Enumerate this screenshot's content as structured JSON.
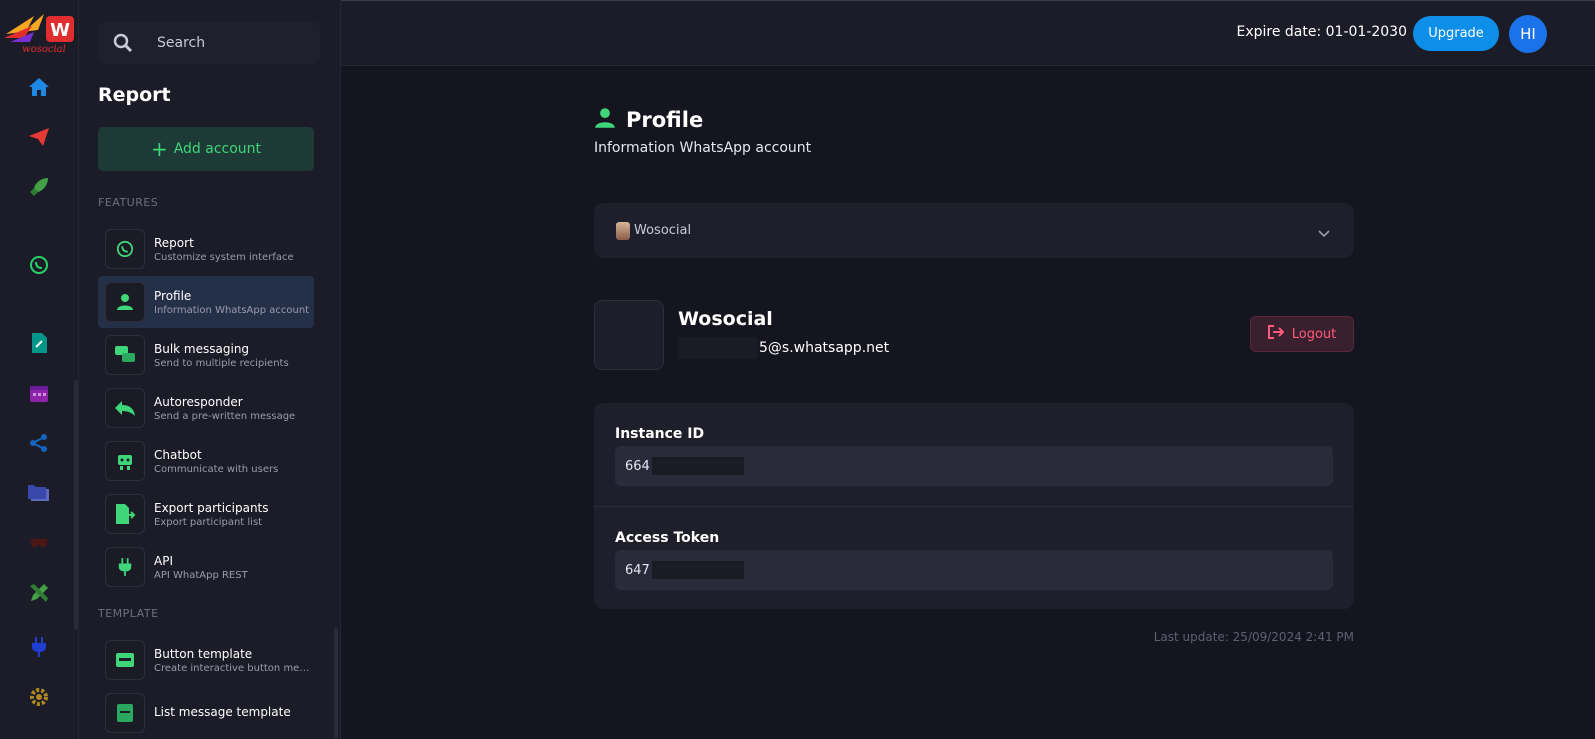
{
  "brand": {
    "logo_text": "wosocial"
  },
  "search": {
    "placeholder": "Search"
  },
  "panel": {
    "title": "Report",
    "add_account_label": "Add account",
    "sections": {
      "features": "FEATURES",
      "template": "TEMPLATE"
    },
    "features": [
      {
        "label": "Report",
        "desc": "Customize system interface"
      },
      {
        "label": "Profile",
        "desc": "Information WhatsApp account"
      },
      {
        "label": "Bulk messaging",
        "desc": "Send to multiple recipients"
      },
      {
        "label": "Autoresponder",
        "desc": "Send a pre-written message"
      },
      {
        "label": "Chatbot",
        "desc": "Communicate with users"
      },
      {
        "label": "Export participants",
        "desc": "Export participant list"
      },
      {
        "label": "API",
        "desc": "API WhatApp REST"
      }
    ],
    "templates": [
      {
        "label": "Button template",
        "desc": "Create interactive button messages"
      },
      {
        "label": "List message template",
        "desc": ""
      }
    ]
  },
  "topbar": {
    "expire": "Expire date: 01-01-2030",
    "upgrade_label": "Upgrade",
    "avatar_initials": "HI"
  },
  "main": {
    "title": "Profile",
    "subtitle": "Information WhatsApp account",
    "account_select": {
      "selected": "Wosocial"
    },
    "account": {
      "name": "Wosocial",
      "jid_suffix": "5@s.whatsapp.net"
    },
    "logout_label": "Logout",
    "instance": {
      "label": "Instance ID",
      "value_prefix": "664"
    },
    "token": {
      "label": "Access Token",
      "value_prefix": "647"
    },
    "last_update": "Last update: 25/09/2024 2:41 PM"
  },
  "colors": {
    "accent": "#0d8fe9",
    "green": "#3fd67a",
    "danger": "#ff5b7a",
    "bg": "#15151f"
  }
}
